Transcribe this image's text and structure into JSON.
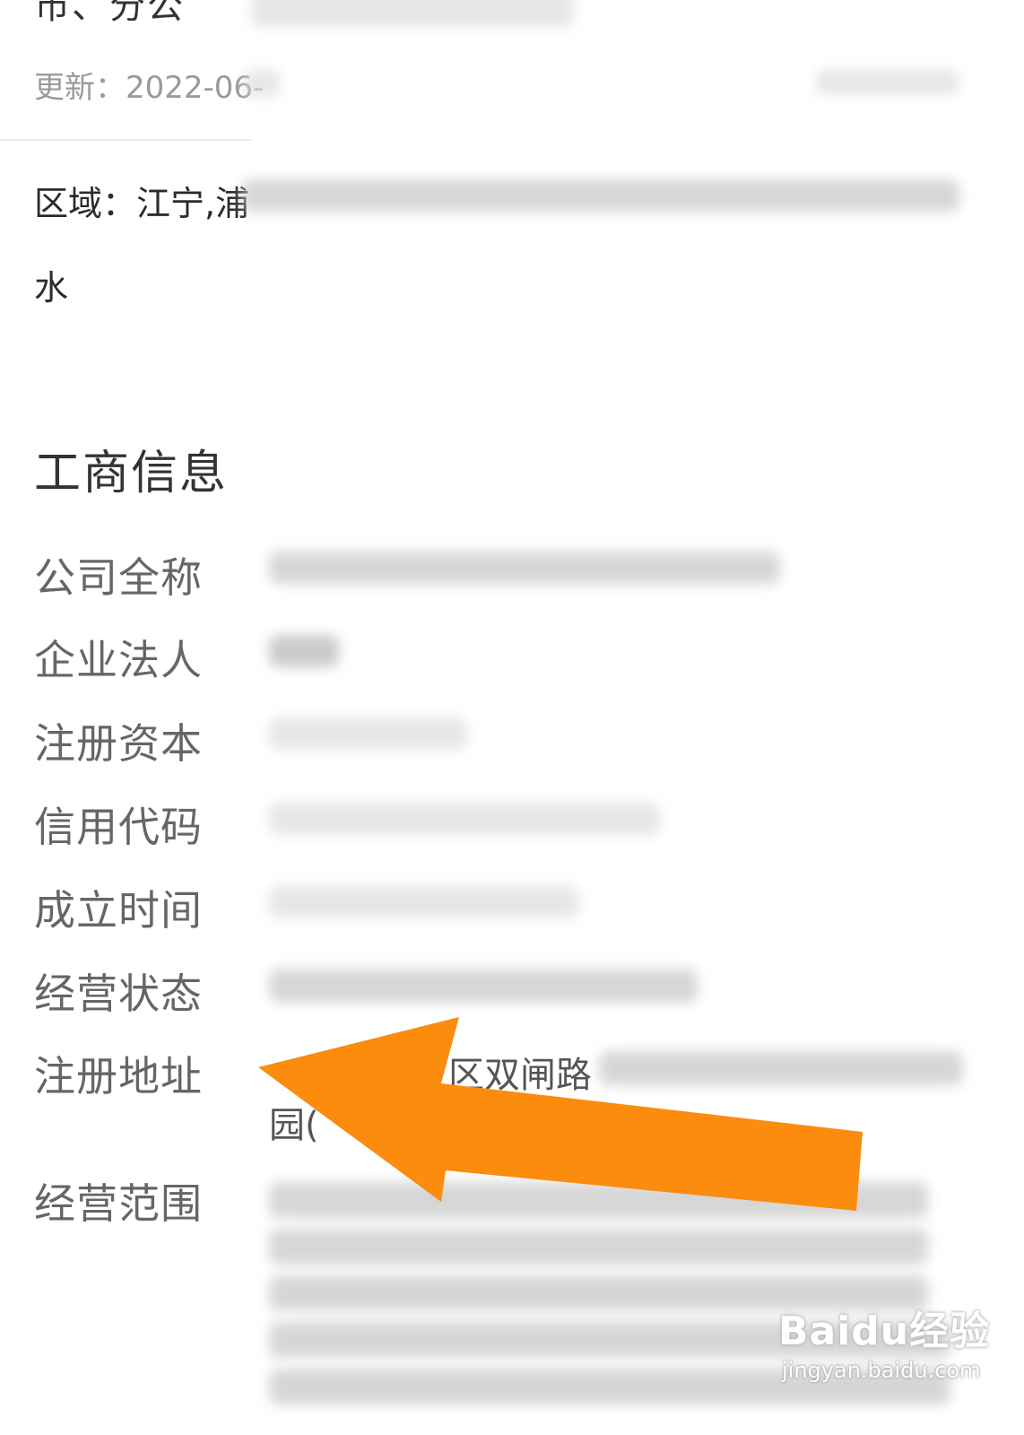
{
  "header": {
    "title_fragment": "市、分公",
    "update_text": "更新：2022-06-"
  },
  "region": {
    "text_line1": "区域：江宁,浦",
    "text_line2": "水"
  },
  "business_info": {
    "section_title": "工商信息",
    "rows": [
      {
        "label": "公司全称"
      },
      {
        "label": "企业法人"
      },
      {
        "label": "注册资本"
      },
      {
        "label": "信用代码"
      },
      {
        "label": "成立时间"
      },
      {
        "label": "经营状态"
      },
      {
        "label": "注册地址"
      },
      {
        "label": "经营范围"
      }
    ],
    "address_fragment_1": "区双闸路",
    "address_fragment_2": "园("
  },
  "annotation": {
    "arrow_color": "#fb8c0e",
    "arrow_direction": "left"
  },
  "watermark": {
    "brand": "Baidu经验",
    "url": "jingyan.baidu.com"
  }
}
